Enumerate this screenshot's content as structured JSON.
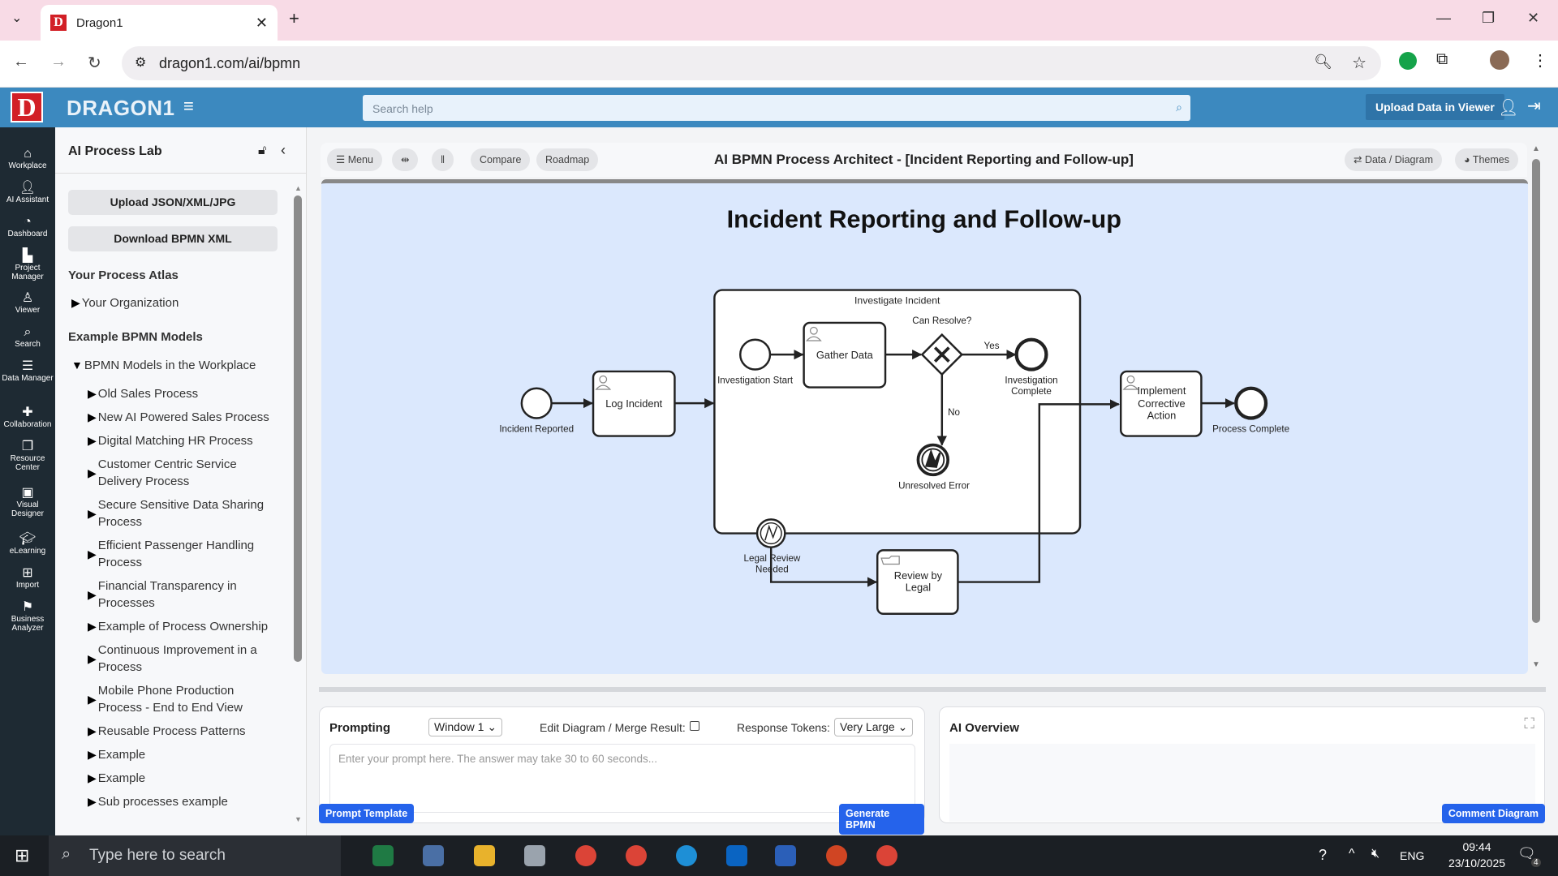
{
  "browser": {
    "tab_title": "Dragon1",
    "url": "dragon1.com/ai/bpmn",
    "new_tab": "+"
  },
  "header": {
    "brand": "DRAGON1",
    "search_placeholder": "Search help",
    "upload_button": "Upload Data in Viewer"
  },
  "rail": [
    {
      "icon": "home-icon",
      "label": "Workplace"
    },
    {
      "icon": "user-plus-icon",
      "label": "AI Assistant"
    },
    {
      "icon": "gauge-icon",
      "label": "Dashboard"
    },
    {
      "icon": "chart-icon",
      "label": "Project Manager"
    },
    {
      "icon": "viewer-icon",
      "label": "Viewer"
    },
    {
      "icon": "search-icon",
      "label": "Search"
    },
    {
      "icon": "list-icon",
      "label": "Data Manager"
    },
    {
      "icon": "puzzle-icon",
      "label": "Collaboration"
    },
    {
      "icon": "copy-icon",
      "label": "Resource Center"
    },
    {
      "icon": "image-icon",
      "label": "Visual Designer"
    },
    {
      "icon": "graduation-cap-icon",
      "label": "eLearning"
    },
    {
      "icon": "table-icon",
      "label": "Import"
    },
    {
      "icon": "flag-icon",
      "label": "Business Analyzer"
    }
  ],
  "panel": {
    "title": "AI Process Lab",
    "upload_btn": "Upload JSON/XML/JPG",
    "download_btn": "Download BPMN XML",
    "atlas_title": "Your Process Atlas",
    "atlas_items": [
      "Your Organization"
    ],
    "examples_title": "Example BPMN Models",
    "group": "BPMN Models in the Workplace",
    "models": [
      "Old Sales Process",
      "New AI Powered Sales Process",
      "Digital Matching HR Process",
      "Customer Centric Service Delivery Process",
      "Secure Sensitive Data Sharing Process",
      "Efficient Passenger Handling Process",
      "Financial Transparency in Processes",
      "Example of Process Ownership",
      "Continuous Improvement in a Process",
      "Mobile Phone Production Process - End to End View",
      "Reusable Process Patterns",
      "Example",
      "Example",
      "Sub processes example"
    ]
  },
  "toolbar": {
    "menu": "Menu",
    "compare": "Compare",
    "roadmap": "Roadmap",
    "title": "AI BPMN Process Architect - [Incident Reporting and Follow-up]",
    "data_diagram": "Data / Diagram",
    "themes": "Themes"
  },
  "diagram": {
    "title": "Incident Reporting and Follow-up",
    "incident_reported": "Incident Reported",
    "log_incident": "Log Incident",
    "subprocess": "Investigate Incident",
    "investigation_start": "Investigation Start",
    "gather_data": "Gather Data",
    "can_resolve": "Can Resolve?",
    "yes": "Yes",
    "no": "No",
    "investigation_complete_1": "Investigation",
    "investigation_complete_2": "Complete",
    "unresolved_error": "Unresolved Error",
    "legal_review_1": "Legal Review",
    "legal_review_2": "Needed",
    "review_legal_1": "Review by",
    "review_legal_2": "Legal",
    "implement_1": "Implement",
    "implement_2": "Corrective",
    "implement_3": "Action",
    "process_complete": "Process Complete"
  },
  "prompting": {
    "title": "Prompting",
    "window": "Window 1",
    "edit_merge": "Edit Diagram / Merge Result:",
    "tokens_label": "Response Tokens:",
    "tokens_value": "Very Large",
    "placeholder": "Enter your prompt here. The answer may take 30 to 60 seconds...",
    "prompt_template": "Prompt Template",
    "generate": "Generate BPMN"
  },
  "overview": {
    "title": "AI Overview",
    "comment": "Comment Diagram"
  },
  "taskbar": {
    "search": "Type here to search",
    "lang": "ENG",
    "time": "09:44",
    "date": "23/10/2025",
    "notifications": "4"
  }
}
